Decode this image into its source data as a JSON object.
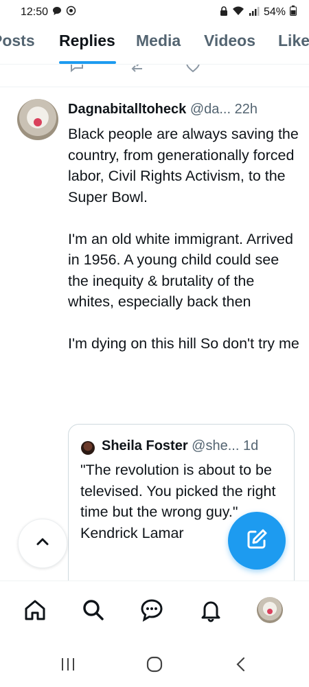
{
  "status_bar": {
    "time": "12:50",
    "battery": "54%"
  },
  "tabs": [
    {
      "label": "Posts",
      "active": false
    },
    {
      "label": "Replies",
      "active": true
    },
    {
      "label": "Media",
      "active": false
    },
    {
      "label": "Videos",
      "active": false
    },
    {
      "label": "Likes",
      "active": false
    }
  ],
  "colors": {
    "accent": "#1d9bf0",
    "text_primary": "#0f1419",
    "text_secondary": "#536471",
    "border": "#cfd9de"
  },
  "post": {
    "display_name": "Dagnabitalltoheck",
    "handle": "@da...",
    "time": "22h",
    "paragraphs": [
      "Black people are always saving the country, from generationally forced labor, Civil Rights Activism, to the Super Bowl.",
      "I'm an old white immigrant. Arrived in 1956. A young child could see the inequity &  brutality of the whites, especially  back then",
      "I'm dying on this hill So don't try me"
    ],
    "quote": {
      "display_name": "Sheila Foster",
      "handle": "@she...",
      "time": "1d",
      "text": "\"The revolution is about to be televised. You picked the right time but the wrong guy.\" Kendrick Lamar"
    }
  },
  "bottom_nav": [
    "home-icon",
    "search-icon",
    "messages-icon",
    "notifications-icon",
    "profile-avatar"
  ],
  "android_nav": [
    "recents-icon",
    "home-circle-icon",
    "back-icon"
  ]
}
